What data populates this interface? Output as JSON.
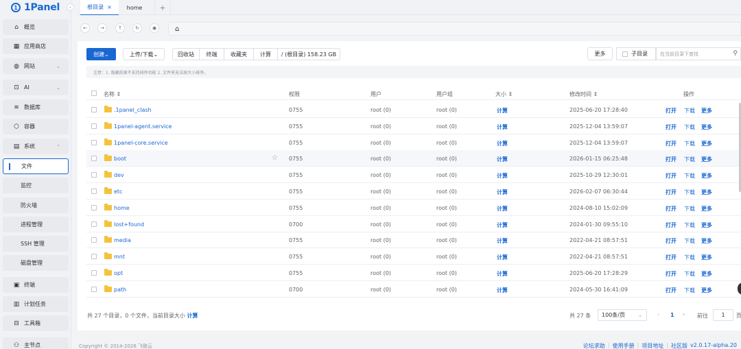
{
  "brand": {
    "name": "1Panel",
    "mark": "1"
  },
  "sidebar": {
    "items": [
      {
        "label": "概览",
        "icon": "home-icon",
        "glyph": "⌂"
      },
      {
        "label": "应用商店",
        "icon": "apps-icon",
        "glyph": "▦"
      },
      {
        "label": "网站",
        "icon": "globe-icon",
        "glyph": "◍",
        "chevron": "⌄"
      },
      {
        "label": "AI",
        "icon": "robot-icon",
        "glyph": "⊡",
        "chevron": "⌄"
      },
      {
        "label": "数据库",
        "icon": "database-icon",
        "glyph": "≋"
      },
      {
        "label": "容器",
        "icon": "container-icon",
        "glyph": "⬡"
      },
      {
        "label": "系统",
        "icon": "system-icon",
        "glyph": "▤",
        "chevron": "⌃"
      }
    ],
    "sub_items": [
      {
        "label": "文件",
        "active": true
      },
      {
        "label": "监控"
      },
      {
        "label": "防火墙"
      },
      {
        "label": "进程管理"
      },
      {
        "label": "SSH 管理"
      },
      {
        "label": "磁盘管理"
      }
    ],
    "items_after": [
      {
        "label": "终端",
        "icon": "terminal-icon",
        "glyph": "▣"
      },
      {
        "label": "计划任务",
        "icon": "cron-icon",
        "glyph": "▥"
      },
      {
        "label": "工具箱",
        "icon": "toolbox-icon",
        "glyph": "⊟"
      },
      {
        "label": "主节点",
        "icon": "node-icon",
        "glyph": "⚇"
      }
    ]
  },
  "tabs": [
    {
      "label": "根目录",
      "close": "×",
      "active": true
    },
    {
      "label": "home"
    }
  ],
  "tab_add": "+",
  "address": {
    "home_glyph": "⌂"
  },
  "toolbar": {
    "create": "创建",
    "create_caret": "⌄",
    "upload_download": "上传/下载",
    "recycle": "回收站",
    "terminal": "终端",
    "favorites": "收藏夹",
    "calculate": "计算",
    "path_info": "/ (根目录) 158.23 GB",
    "more": "更多",
    "subdir": "子目录",
    "search_placeholder": "在当前目录下查找"
  },
  "notice": "注意：1. 隐藏前果不支持排序功能 2. 文件夹无法按大小排序。",
  "table": {
    "headers": {
      "name": "名称",
      "perm": "权限",
      "user": "用户",
      "group": "用户组",
      "size": "大小",
      "mtime": "修改时间",
      "ops": "操作"
    },
    "sort_glyph": "⇕",
    "rows": [
      {
        "name": ".1panel_clash",
        "perm": "0755",
        "user": "root (0)",
        "group": "root (0)",
        "size": "计算",
        "mtime": "2025-06-20 17:28:40"
      },
      {
        "name": "1panel-agent.service",
        "perm": "0755",
        "user": "root (0)",
        "group": "root (0)",
        "size": "计算",
        "mtime": "2025-12-04 13:59:07"
      },
      {
        "name": "1panel-core.service",
        "perm": "0755",
        "user": "root (0)",
        "group": "root (0)",
        "size": "计算",
        "mtime": "2025-12-04 13:59:07"
      },
      {
        "name": "boot",
        "perm": "0755",
        "user": "root (0)",
        "group": "root (0)",
        "size": "计算",
        "mtime": "2026-01-15 06:25:48"
      },
      {
        "name": "dev",
        "perm": "0755",
        "user": "root (0)",
        "group": "root (0)",
        "size": "计算",
        "mtime": "2025-10-29 12:30:01"
      },
      {
        "name": "etc",
        "perm": "0755",
        "user": "root (0)",
        "group": "root (0)",
        "size": "计算",
        "mtime": "2026-02-07 06:30:44"
      },
      {
        "name": "home",
        "perm": "0755",
        "user": "root (0)",
        "group": "root (0)",
        "size": "计算",
        "mtime": "2024-08-10 15:02:09"
      },
      {
        "name": "lost+found",
        "perm": "0700",
        "user": "root (0)",
        "group": "root (0)",
        "size": "计算",
        "mtime": "2024-01-30 09:55:10"
      },
      {
        "name": "media",
        "perm": "0755",
        "user": "root (0)",
        "group": "root (0)",
        "size": "计算",
        "mtime": "2022-04-21 08:57:51"
      },
      {
        "name": "mnt",
        "perm": "0755",
        "user": "root (0)",
        "group": "root (0)",
        "size": "计算",
        "mtime": "2022-04-21 08:57:51"
      },
      {
        "name": "opt",
        "perm": "0755",
        "user": "root (0)",
        "group": "root (0)",
        "size": "计算",
        "mtime": "2025-06-20 17:28:29"
      },
      {
        "name": "path",
        "perm": "0700",
        "user": "root (0)",
        "group": "root (0)",
        "size": "计算",
        "mtime": "2024-05-30 16:41:09"
      }
    ],
    "ops": {
      "open": "打开",
      "download": "下载",
      "more": "更多"
    },
    "star_glyph": "☆"
  },
  "footer": {
    "summary": "共 27 个目录，0 个文件，当前目录大小",
    "calc_link": "计算",
    "total": "共 27 条",
    "page_size": "100条/页",
    "prev": "‹",
    "current_page": "1",
    "next": "›",
    "goto": "前往",
    "goto_value": "1",
    "page_suffix": "页"
  },
  "bottom": {
    "copyright": "Copyright © 2014-2026 飞致云",
    "links": [
      "论坛求助",
      "使用手册",
      "项目地址"
    ],
    "edition": "社区版",
    "version": "v2.0.17-alpha.20"
  }
}
